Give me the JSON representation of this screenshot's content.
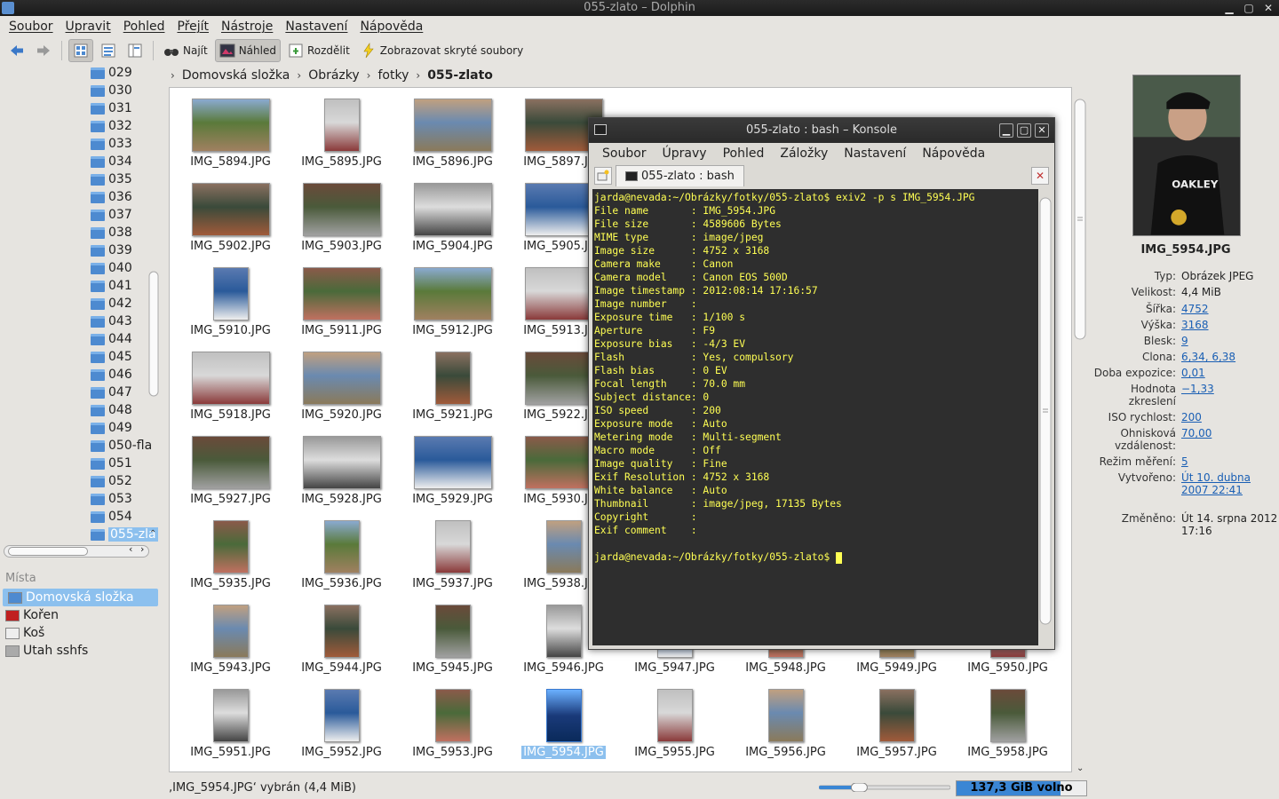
{
  "window": {
    "title": "055-zlato – Dolphin"
  },
  "menu": [
    "Soubor",
    "Upravit",
    "Pohled",
    "Přejít",
    "Nástroje",
    "Nastavení",
    "Nápověda"
  ],
  "toolbar": {
    "find": "Najít",
    "preview": "Náhled",
    "split": "Rozdělit",
    "hidden": "Zobrazovat skryté soubory"
  },
  "tree": {
    "items": [
      "029",
      "030",
      "031",
      "032",
      "033",
      "034",
      "035",
      "036",
      "037",
      "038",
      "039",
      "040",
      "041",
      "042",
      "043",
      "044",
      "045",
      "046",
      "047",
      "048",
      "049",
      "050-fla",
      "051",
      "052",
      "053",
      "054",
      "055-zla"
    ],
    "selected": "055-zla"
  },
  "places": {
    "header": "Místa",
    "items": [
      {
        "label": "Domovská složka",
        "icon": "home-folder-icon",
        "selected": true
      },
      {
        "label": "Kořen",
        "icon": "root-folder-icon",
        "selected": false
      },
      {
        "label": "Koš",
        "icon": "trash-icon",
        "selected": false
      },
      {
        "label": "Utah sshfs",
        "icon": "network-drive-icon",
        "selected": false
      }
    ]
  },
  "breadcrumb": [
    "Domovská složka",
    "Obrázky",
    "fotky",
    "055-zlato"
  ],
  "files": [
    [
      "IMG_5894.JPG",
      "IMG_5895.JPG",
      "IMG_5896.JPG",
      "IMG_5897.JPG",
      "",
      "",
      "",
      ""
    ],
    [
      "IMG_5902.JPG",
      "IMG_5903.JPG",
      "IMG_5904.JPG",
      "IMG_5905.JPG",
      "",
      "",
      "",
      ""
    ],
    [
      "IMG_5910.JPG",
      "IMG_5911.JPG",
      "IMG_5912.JPG",
      "IMG_5913.JPG",
      "",
      "",
      "",
      ""
    ],
    [
      "IMG_5918.JPG",
      "IMG_5920.JPG",
      "IMG_5921.JPG",
      "IMG_5922.JPG",
      "",
      "",
      "",
      ""
    ],
    [
      "IMG_5927.JPG",
      "IMG_5928.JPG",
      "IMG_5929.JPG",
      "IMG_5930.JPG",
      "",
      "",
      "",
      ""
    ],
    [
      "IMG_5935.JPG",
      "IMG_5936.JPG",
      "IMG_5937.JPG",
      "IMG_5938.JPG",
      "",
      "",
      "",
      ""
    ],
    [
      "IMG_5943.JPG",
      "IMG_5944.JPG",
      "IMG_5945.JPG",
      "IMG_5946.JPG",
      "IMG_5947.JPG",
      "IMG_5948.JPG",
      "IMG_5949.JPG",
      "IMG_5950.JPG"
    ],
    [
      "IMG_5951.JPG",
      "IMG_5952.JPG",
      "IMG_5953.JPG",
      "IMG_5954.JPG",
      "IMG_5955.JPG",
      "IMG_5956.JPG",
      "IMG_5957.JPG",
      "IMG_5958.JPG"
    ]
  ],
  "selected_file": "IMG_5954.JPG",
  "konsole": {
    "title": "055-zlato : bash – Konsole",
    "menu": [
      "Soubor",
      "Úpravy",
      "Pohled",
      "Záložky",
      "Nastavení",
      "Nápověda"
    ],
    "tab": "055-zlato : bash",
    "lines": [
      "jarda@nevada:~/Obrázky/fotky/055-zlato$ exiv2 -p s IMG_5954.JPG",
      "File name       : IMG_5954.JPG",
      "File size       : 4589606 Bytes",
      "MIME type       : image/jpeg",
      "Image size      : 4752 x 3168",
      "Camera make     : Canon",
      "Camera model    : Canon EOS 500D",
      "Image timestamp : 2012:08:14 17:16:57",
      "Image number    :",
      "Exposure time   : 1/100 s",
      "Aperture        : F9",
      "Exposure bias   : -4/3 EV",
      "Flash           : Yes, compulsory",
      "Flash bias      : 0 EV",
      "Focal length    : 70.0 mm",
      "Subject distance: 0",
      "ISO speed       : 200",
      "Exposure mode   : Auto",
      "Metering mode   : Multi-segment",
      "Macro mode      : Off",
      "Image quality   : Fine",
      "Exif Resolution : 4752 x 3168",
      "White balance   : Auto",
      "Thumbnail       : image/jpeg, 17135 Bytes",
      "Copyright       :",
      "Exif comment    :",
      "",
      "jarda@nevada:~/Obrázky/fotky/055-zlato$ "
    ]
  },
  "info": {
    "filename": "IMG_5954.JPG",
    "rows": [
      {
        "k": "Typ:",
        "v": "Obrázek JPEG",
        "link": false
      },
      {
        "k": "Velikost:",
        "v": "4,4 MiB",
        "link": false
      },
      {
        "k": "Šířka:",
        "v": "4752",
        "link": true
      },
      {
        "k": "Výška:",
        "v": "3168",
        "link": true
      },
      {
        "k": "Blesk:",
        "v": "9",
        "link": true
      },
      {
        "k": "Clona:",
        "v": "6,34, 6,38",
        "link": true
      },
      {
        "k": "Doba expozice:",
        "v": "0,01",
        "link": true
      },
      {
        "k": "Hodnota zkreslení",
        "v": "−1,33",
        "link": true
      },
      {
        "k": "ISO rychlost:",
        "v": "200",
        "link": true
      },
      {
        "k": "Ohnisková vzdálenost:",
        "v": "70,00",
        "link": true
      },
      {
        "k": "Režim měření:",
        "v": "5",
        "link": true
      },
      {
        "k": "Vytvořeno:",
        "v": "Út 10. dubna 2007 22:41",
        "link": true
      },
      {
        "k": "Změněno:",
        "v": "Út 14. srpna 2012 17:16",
        "link": false
      }
    ]
  },
  "status": {
    "text": "‚IMG_5954.JPG‘ vybrán (4,4 MiB)",
    "free_space": "137,3 GiB volno",
    "used_fraction": 0.8,
    "zoom_fraction": 0.28
  },
  "colors": {
    "selection": "#8cc0ee",
    "terminal_bg": "#2e2e2e",
    "terminal_fg": "#ffff54",
    "folder": "#4d8ad0"
  }
}
